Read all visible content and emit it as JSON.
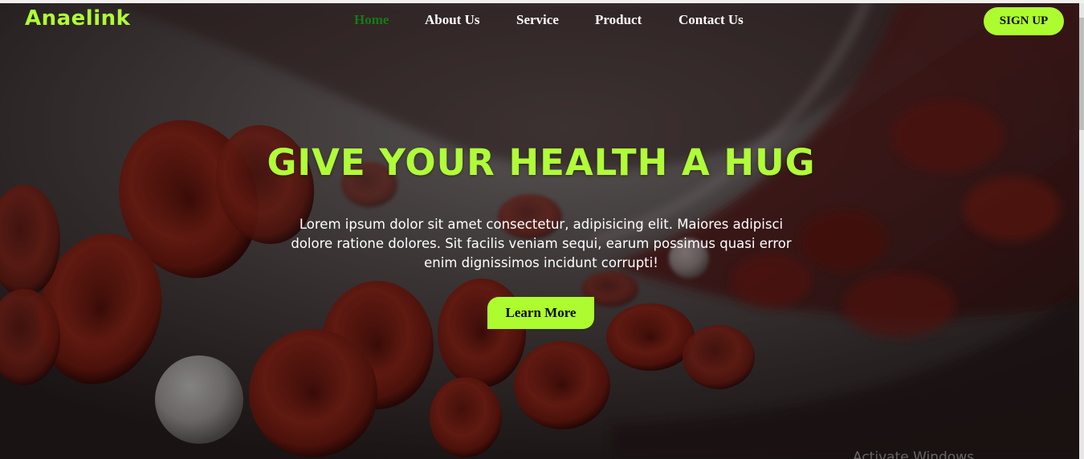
{
  "header": {
    "logo_text": "Anaelink",
    "nav": [
      {
        "label": "Home",
        "active": true
      },
      {
        "label": "About Us",
        "active": false
      },
      {
        "label": "Service",
        "active": false
      },
      {
        "label": "Product",
        "active": false
      },
      {
        "label": "Contact Us",
        "active": false
      }
    ],
    "signup_label": "SIGN UP"
  },
  "hero": {
    "headline": "GIVE YOUR HEALTH A HUG",
    "text": "Lorem ipsum dolor sit amet consectetur, adipisicing elit. Maiores adipisci dolore ratione dolores. Sit facilis veniam sequi, earum possimus quasi error enim dignissimos incidunt corrupti!",
    "button_label": "Learn More",
    "background_image": "red-blood-cells-in-vessel"
  },
  "overlay": {
    "watermark_text": "Activate Windows"
  },
  "colors": {
    "accent": "#adfc2f",
    "nav_active": "#157a15",
    "nav_text": "#ffffff"
  }
}
